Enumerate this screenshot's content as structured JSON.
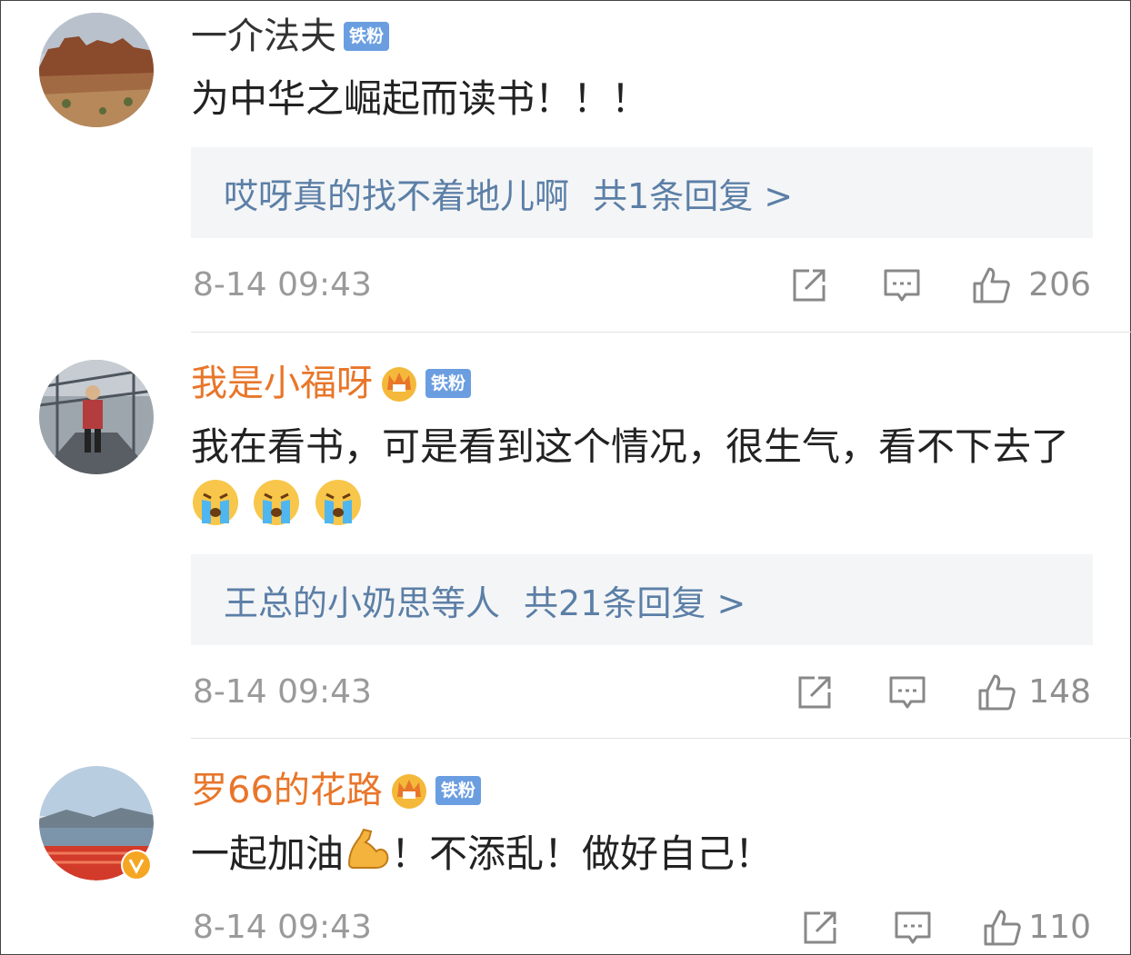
{
  "comments": [
    {
      "username": "一介法夫",
      "badge": "铁粉",
      "text": "为中华之崛起而读书！！！",
      "reply_preview": {
        "text": "哎呀真的找不着地儿啊",
        "count": "共1条回复 >"
      },
      "time": "8-14 09:43",
      "likes": "206"
    },
    {
      "username": "我是小福呀",
      "badge": "铁粉",
      "text": "我在看书，可是看到这个情况，很生气，看不下去了",
      "reply_preview": {
        "text": "王总的小奶思等人",
        "count": "共21条回复 >"
      },
      "time": "8-14 09:43",
      "likes": "148"
    },
    {
      "username": "罗66的花路",
      "badge": "铁粉",
      "text_parts": [
        "一起加油",
        "！不添乱！做好自己！"
      ],
      "time": "8-14 09:43",
      "likes": "110"
    }
  ],
  "colors": {
    "vip_name": "#e8762a",
    "badge_bg": "#6b9ee0",
    "reply_link": "#5b7fa6",
    "meta_gray": "#9a9a9a"
  },
  "icons": {
    "repost": "repost-icon",
    "comment": "comment-icon",
    "like": "thumbs-up-icon",
    "vip": "crown-icon",
    "crying": "crying-emoji-icon",
    "muscle": "flexed-biceps-emoji-icon",
    "verified": "verified-v-icon"
  }
}
